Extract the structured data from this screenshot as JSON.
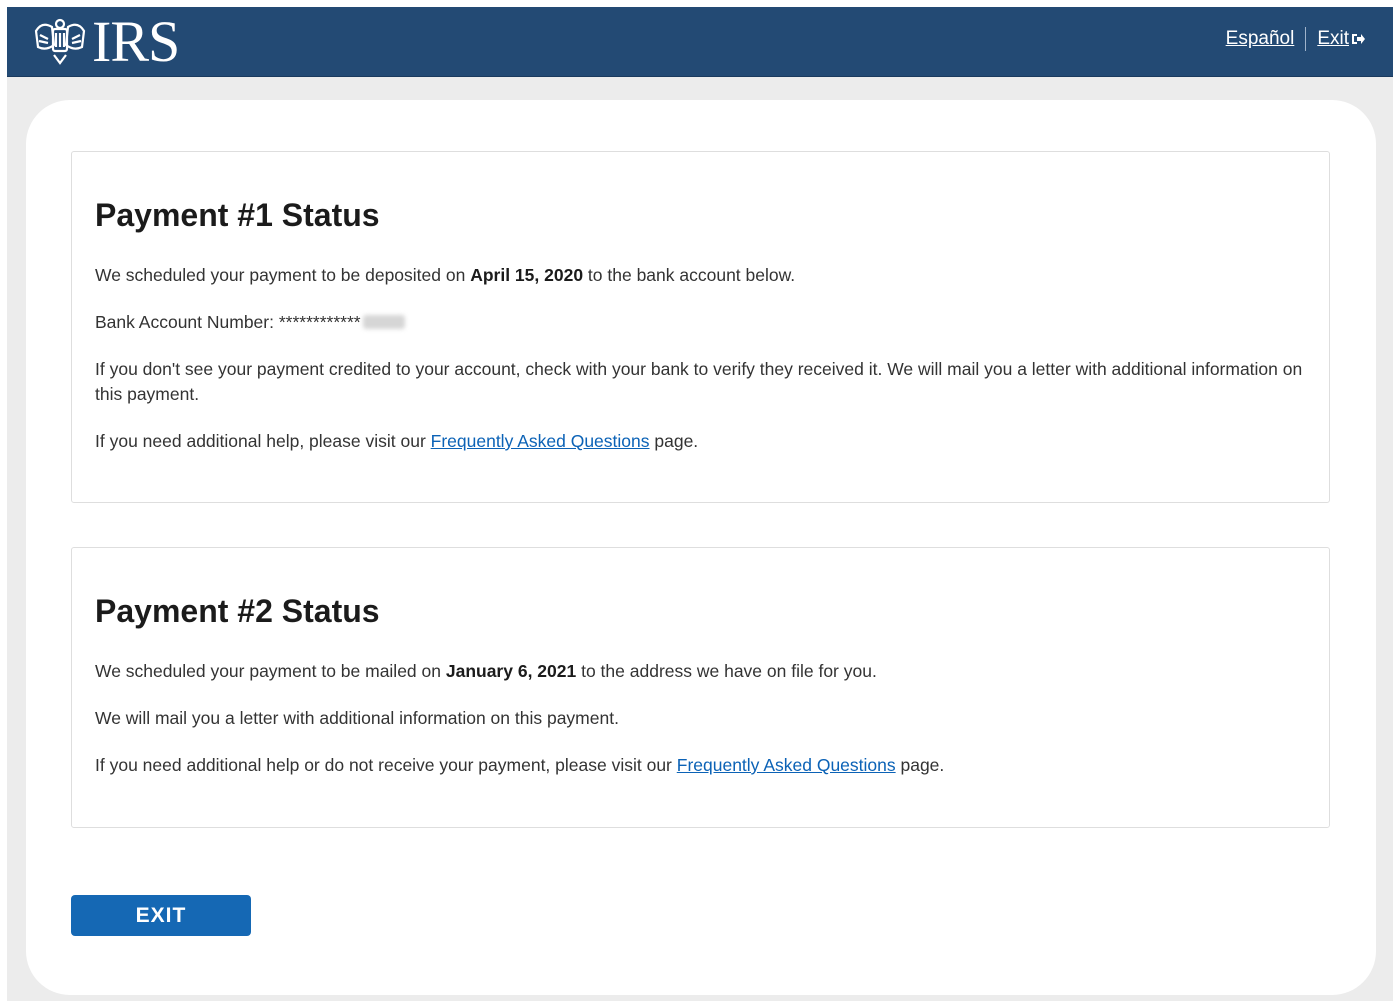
{
  "header": {
    "logo_text": "IRS",
    "logo_icon": "irs-eagle-icon",
    "espanol_link": "Español",
    "exit_link": "Exit",
    "exit_icon": "exit-arrow-icon",
    "background": "#234a74"
  },
  "payment1": {
    "title": "Payment #1 Status",
    "sched_prefix": "We scheduled your payment to be deposited on ",
    "sched_date": "April 15, 2020",
    "sched_suffix": " to the bank account below.",
    "bank_label": "Bank Account Number: ",
    "bank_masked": "************",
    "credit_text": "If you don't see your payment credited to your account, check with your bank to verify they received it. We will mail you a letter with additional information on this payment.",
    "help_prefix": "If you need additional help, please visit our ",
    "help_link": "Frequently Asked Questions",
    "help_suffix": " page."
  },
  "payment2": {
    "title": "Payment #2 Status",
    "sched_prefix": "We scheduled your payment to be mailed on ",
    "sched_date": "January 6, 2021",
    "sched_suffix": " to the address we have on file for you.",
    "mail_text": "We will mail you a letter with additional information on this payment.",
    "help_prefix": "If you need additional help or do not receive your payment, please visit our ",
    "help_link": "Frequently Asked Questions",
    "help_suffix": " page."
  },
  "exit_button": "EXIT",
  "colors": {
    "link": "#0b62b6",
    "button": "#1568b4"
  }
}
